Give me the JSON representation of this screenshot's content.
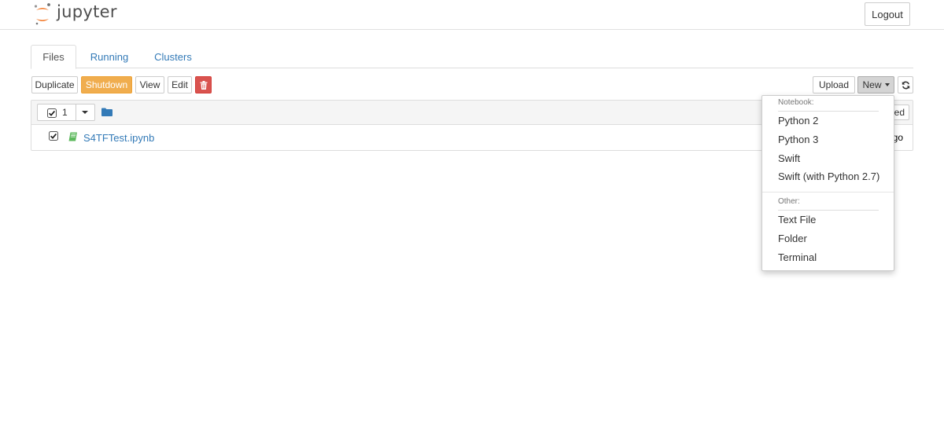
{
  "app": {
    "logo_text": "jupyter"
  },
  "header": {
    "logout_label": "Logout"
  },
  "tabs": [
    {
      "label": "Files",
      "active": true
    },
    {
      "label": "Running",
      "active": false
    },
    {
      "label": "Clusters",
      "active": false
    }
  ],
  "toolbar": {
    "duplicate_label": "Duplicate",
    "shutdown_label": "Shutdown",
    "view_label": "View",
    "edit_label": "Edit",
    "delete_icon": "trash-icon",
    "upload_label": "Upload",
    "new_label": "New",
    "refresh_icon": "refresh-icon"
  },
  "file_list": {
    "selected_count": "1",
    "sort_label_fragment": "ed",
    "rows": [
      {
        "name": "S4TFTest.ipynb",
        "checked": true,
        "icon": "notebook-icon",
        "modified_fragment": "go"
      }
    ]
  },
  "new_menu": {
    "notebook_header": "Notebook:",
    "notebook_items": [
      "Python 2",
      "Python 3",
      "Swift",
      "Swift (with Python 2.7)"
    ],
    "other_header": "Other:",
    "other_items": [
      "Text File",
      "Folder",
      "Terminal"
    ]
  },
  "colors": {
    "link": "#337ab7",
    "warning": "#f0ad4e",
    "danger": "#d9534f",
    "logo_orange": "#f37726",
    "notebook_green": "#5cb85c"
  }
}
